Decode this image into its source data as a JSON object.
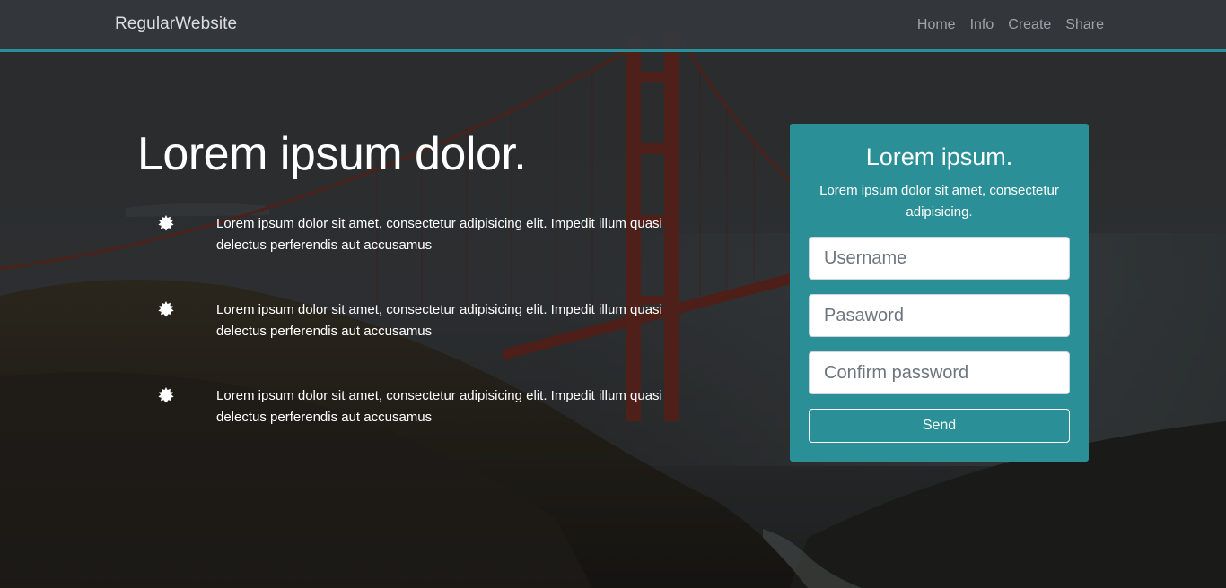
{
  "navbar": {
    "brand": "RegularWebsite",
    "links": [
      "Home",
      "Info",
      "Create",
      "Share"
    ]
  },
  "hero": {
    "title_part1": "Lorem ",
    "title_strong": "ipsum",
    "title_part2": " dolor.",
    "features": [
      {
        "icon": "burst-icon",
        "text": "Lorem ipsum dolor sit amet, consectetur adipisicing elit. Impedit illum quasi delectus perferendis aut accusamus"
      },
      {
        "icon": "burst-icon",
        "text": "Lorem ipsum dolor sit amet, consectetur adipisicing elit. Impedit illum quasi delectus perferendis aut accusamus"
      },
      {
        "icon": "burst-icon",
        "text": "Lorem ipsum dolor sit amet, consectetur adipisicing elit. Impedit illum quasi delectus perferendis aut accusamus"
      }
    ]
  },
  "signup": {
    "title": "Lorem ipsum.",
    "subtitle": "Lorem ipsum dolor sit amet, consectetur adipisicing.",
    "username_placeholder": "Username",
    "password_placeholder": "Pasaword",
    "confirm_placeholder": "Confirm password",
    "send_label": "Send"
  },
  "colors": {
    "accent": "#2a8f97",
    "navbar_bg": "#34383e",
    "text_light": "#ffffff"
  }
}
